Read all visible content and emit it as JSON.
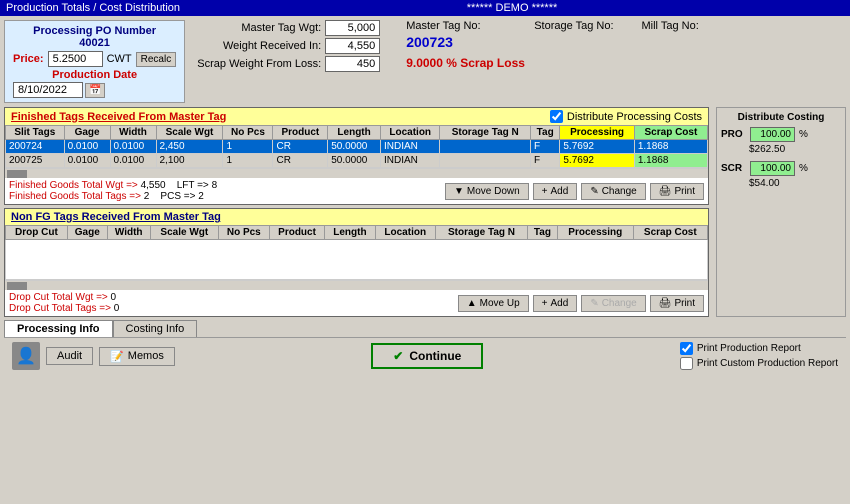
{
  "titleBar": {
    "left": "Production Totals / Cost Distribution",
    "center": "****** DEMO ******"
  },
  "header": {
    "poLabel": "Processing PO Number",
    "poNumber": "40021",
    "priceLabel": "Price:",
    "priceValue": "5.2500",
    "cwtLabel": "CWT",
    "recalcLabel": "Recalc",
    "prodDateLabel": "Production Date",
    "prodDate": "8/10/2022",
    "masterTagWgtLabel": "Master Tag Wgt:",
    "masterTagWgt": "5,000",
    "weightReceivedLabel": "Weight Received In:",
    "weightReceived": "4,550",
    "scrapWeightLabel": "Scrap Weight From Loss:",
    "scrapWeight": "450",
    "masterTagNoLabel": "Master Tag No:",
    "masterTagNo": "200723",
    "storageTagNoLabel": "Storage Tag No:",
    "storageTagNo": "",
    "millTagNoLabel": "Mill Tag No:",
    "millTagNo": "",
    "scrapLoss": "9.0000 % Scrap Loss"
  },
  "fgSection": {
    "title": "Finished Tags Received From Master Tag",
    "distributeLabel": "Distribute Processing Costs",
    "columns": [
      "Slit Tags",
      "Gage",
      "Width",
      "Scale Wgt",
      "No Pcs",
      "Product",
      "Length",
      "Location",
      "Storage Tag N",
      "Tag",
      "Processing",
      "Scrap Cost"
    ],
    "rows": [
      {
        "slitTags": "200724",
        "gage": "0.0100",
        "width": "0.0100",
        "scaleWgt": "2,450",
        "noPcs": "1",
        "product": "CR",
        "length": "50.0000",
        "location": "INDIAN",
        "storageTagN": "",
        "tag": "F",
        "processing": "5.7692",
        "scrapCost": "1.1868",
        "selected": true
      },
      {
        "slitTags": "200725",
        "gage": "0.0100",
        "width": "0.0100",
        "scaleWgt": "2,100",
        "noPcs": "1",
        "product": "CR",
        "length": "50.0000",
        "location": "INDIAN",
        "storageTagN": "",
        "tag": "F",
        "processing": "5.7692",
        "scrapCost": "1.1868",
        "selected": false
      }
    ],
    "totals": {
      "fgTotalWgtLabel": "Finished Goods Total Wgt =>",
      "fgTotalWgt": "4,550",
      "lftLabel": "LFT =>",
      "lftValue": "8",
      "fgTotalTagsLabel": "Finished Goods Total Tags =>",
      "fgTotalTags": "2",
      "pcsLabel": "PCS =>",
      "pcsValue": "2"
    },
    "buttons": {
      "moveDown": "Move Down",
      "add": "Add",
      "change": "Change",
      "print": "Print"
    }
  },
  "distributeCosting": {
    "title": "Distribute Costing",
    "proLabel": "PRO",
    "proValue": "100.00",
    "proPct": "%",
    "proAmount": "$262.50",
    "scrLabel": "SCR",
    "scrValue": "100.00",
    "scrPct": "%",
    "scrAmount": "$54.00"
  },
  "nonFgSection": {
    "title": "Non FG Tags Received From Master Tag",
    "columns": [
      "Drop Cut",
      "Gage",
      "Width",
      "Scale Wgt",
      "No Pcs",
      "Product",
      "Length",
      "Location",
      "Storage Tag N",
      "Tag",
      "Processing",
      "Scrap Cost"
    ],
    "rows": [],
    "totals": {
      "dropCutTotalWgtLabel": "Drop Cut Total Wgt =>",
      "dropCutTotalWgt": "0",
      "dropCutTotalTagsLabel": "Drop Cut Total Tags =>",
      "dropCutTotalTags": "0"
    },
    "buttons": {
      "moveUp": "Move Up",
      "add": "Add",
      "change": "Change",
      "print": "Print"
    }
  },
  "bottomTabs": [
    {
      "label": "Processing Info",
      "active": true
    },
    {
      "label": "Costing Info",
      "active": false
    }
  ],
  "bottomBar": {
    "auditLabel": "Audit",
    "memosLabel": "Memos",
    "continueLabel": "Continue",
    "printProductionReport": "Print Production Report",
    "printCustomProductionReport": "Print Custom Production Report"
  }
}
